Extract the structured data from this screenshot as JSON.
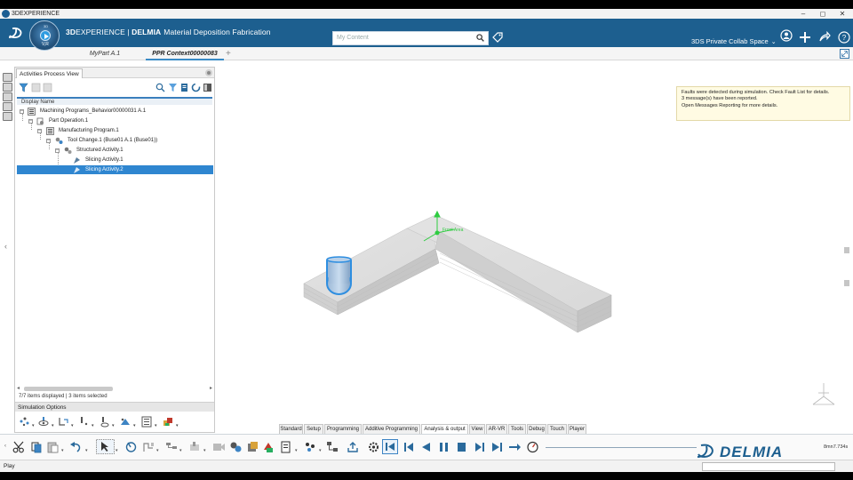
{
  "os_titlebar": {
    "title": "3DEXPERIENCE",
    "minimize": "–",
    "restore": "◻",
    "close": "✕"
  },
  "topbar": {
    "brand_prefix": "3D",
    "brand_mid": "EXPERIENCE",
    "brand_sep": " | ",
    "brand_product": "DELMIA",
    "app_name": "Material Deposition Fabrication",
    "compass_label": "V,R",
    "compass_3d": "3D",
    "search_placeholder": "My Content",
    "collab_space": "3DS Private Collab Space",
    "accent": "#1d5f8f"
  },
  "doc_tabs": [
    {
      "label": "MyPart A.1",
      "active": false
    },
    {
      "label": "PPR Context00000083",
      "active": true
    }
  ],
  "panel": {
    "tab_label": "Activities Process View",
    "column_header": "Display Name",
    "tree": [
      {
        "label": "Machining Programs_Behavior00000031 A.1",
        "level": 0,
        "icon": "program-icon",
        "selected": false
      },
      {
        "label": "Part Operation.1",
        "level": 1,
        "icon": "operation-icon",
        "selected": false
      },
      {
        "label": "Manufacturing Program.1",
        "level": 2,
        "icon": "mfg-program-icon",
        "selected": false
      },
      {
        "label": "Tool Change.1 (Buse01 A.1 (Buse01))",
        "level": 3,
        "icon": "tool-change-icon",
        "selected": false
      },
      {
        "label": "Structured Activity.1",
        "level": 4,
        "icon": "structured-activity-icon",
        "selected": false
      },
      {
        "label": "Slicing Activity.1",
        "level": 5,
        "icon": "slicing-activity-icon",
        "selected": false
      },
      {
        "label": "Slicing Activity.2",
        "level": 5,
        "icon": "slicing-activity-icon",
        "selected": true
      }
    ],
    "status_count": "7/7 items displayed | 3 items selected",
    "sim_options_label": "Simulation Options"
  },
  "notice": {
    "lines": [
      "Faults were detected during simulation. Check Fault List for details.",
      "3 message(s) have been reported.",
      "Open Messages Reporting for more details."
    ]
  },
  "viewport": {
    "frame_label": "Front Area",
    "frame_color": "#2ecc40"
  },
  "command_tabs": [
    {
      "label": "Standard",
      "active": false
    },
    {
      "label": "Setup",
      "active": false
    },
    {
      "label": "Programming",
      "active": false
    },
    {
      "label": "Additive Programming",
      "active": false
    },
    {
      "label": "Analysis & output",
      "active": true
    },
    {
      "label": "View",
      "active": false
    },
    {
      "label": "AR-VR",
      "active": false
    },
    {
      "label": "Tools",
      "active": false
    },
    {
      "label": "Debug",
      "active": false
    },
    {
      "label": "Touch",
      "active": false
    },
    {
      "label": "Player",
      "active": false
    }
  ],
  "player": {
    "timecode": "8mn7.734s",
    "logo_text": "DELMIA"
  },
  "statusbar": {
    "text": "Play"
  }
}
